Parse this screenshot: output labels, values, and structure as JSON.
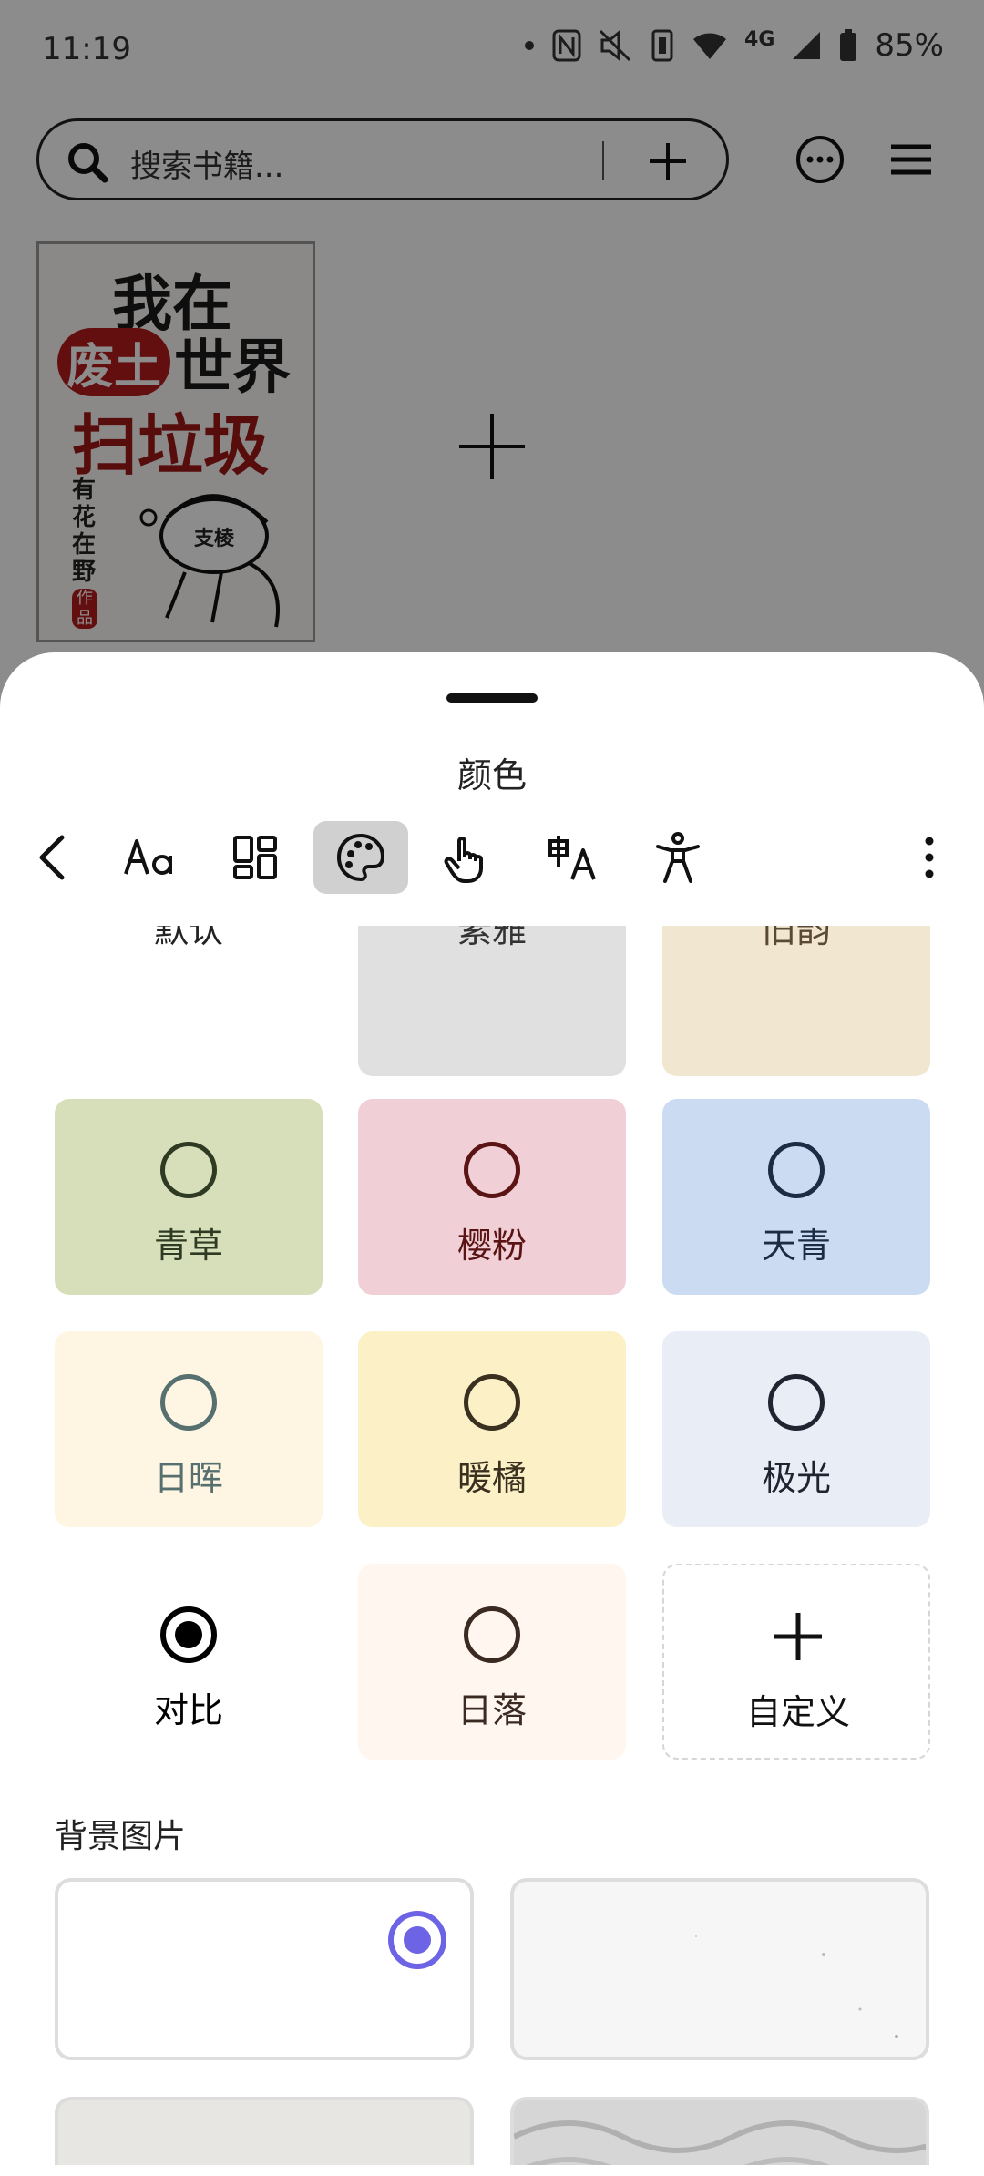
{
  "status": {
    "time": "11:19",
    "network": "4G",
    "battery": "85%"
  },
  "search": {
    "placeholder": "搜索书籍..."
  },
  "book": {
    "title_line1": "我在",
    "title_line2a": "废土",
    "title_line2b": "世界",
    "title_line3": "扫垃圾",
    "author": "有花在野",
    "author_tag": "作品",
    "figure_text": "支棱"
  },
  "sheet": {
    "title": "颜色"
  },
  "toolbar": {
    "items": [
      "back",
      "font",
      "layout",
      "color",
      "gesture",
      "translate",
      "accessibility",
      "more"
    ]
  },
  "themes": [
    {
      "label": "默认",
      "bg": "#ffffff",
      "fg": "#222222"
    },
    {
      "label": "素雅",
      "bg": "#e0e0e0",
      "fg": "#333333"
    },
    {
      "label": "旧韵",
      "bg": "#f1e7d0",
      "fg": "#5a4a35"
    },
    {
      "label": "青草",
      "bg": "#d7deba",
      "fg": "#2e3a22"
    },
    {
      "label": "樱粉",
      "bg": "#f0d0d6",
      "fg": "#5a1414"
    },
    {
      "label": "天青",
      "bg": "#cbdcf2",
      "fg": "#1c2c44"
    },
    {
      "label": "日晖",
      "bg": "#fff5e3",
      "fg": "#56706f"
    },
    {
      "label": "暖橘",
      "bg": "#fbf0c6",
      "fg": "#3a3020"
    },
    {
      "label": "极光",
      "bg": "#e8edf6",
      "fg": "#1e2530"
    },
    {
      "label": "对比",
      "bg": "#ffffff",
      "fg": "#000000",
      "selected": true
    },
    {
      "label": "日落",
      "bg": "#fff6f0",
      "fg": "#3a2a22"
    },
    {
      "label": "自定义",
      "bg": "#ffffff",
      "fg": "#111111",
      "custom": true
    }
  ],
  "background_section": {
    "label": "背景图片"
  },
  "accent": "#6c63e5"
}
